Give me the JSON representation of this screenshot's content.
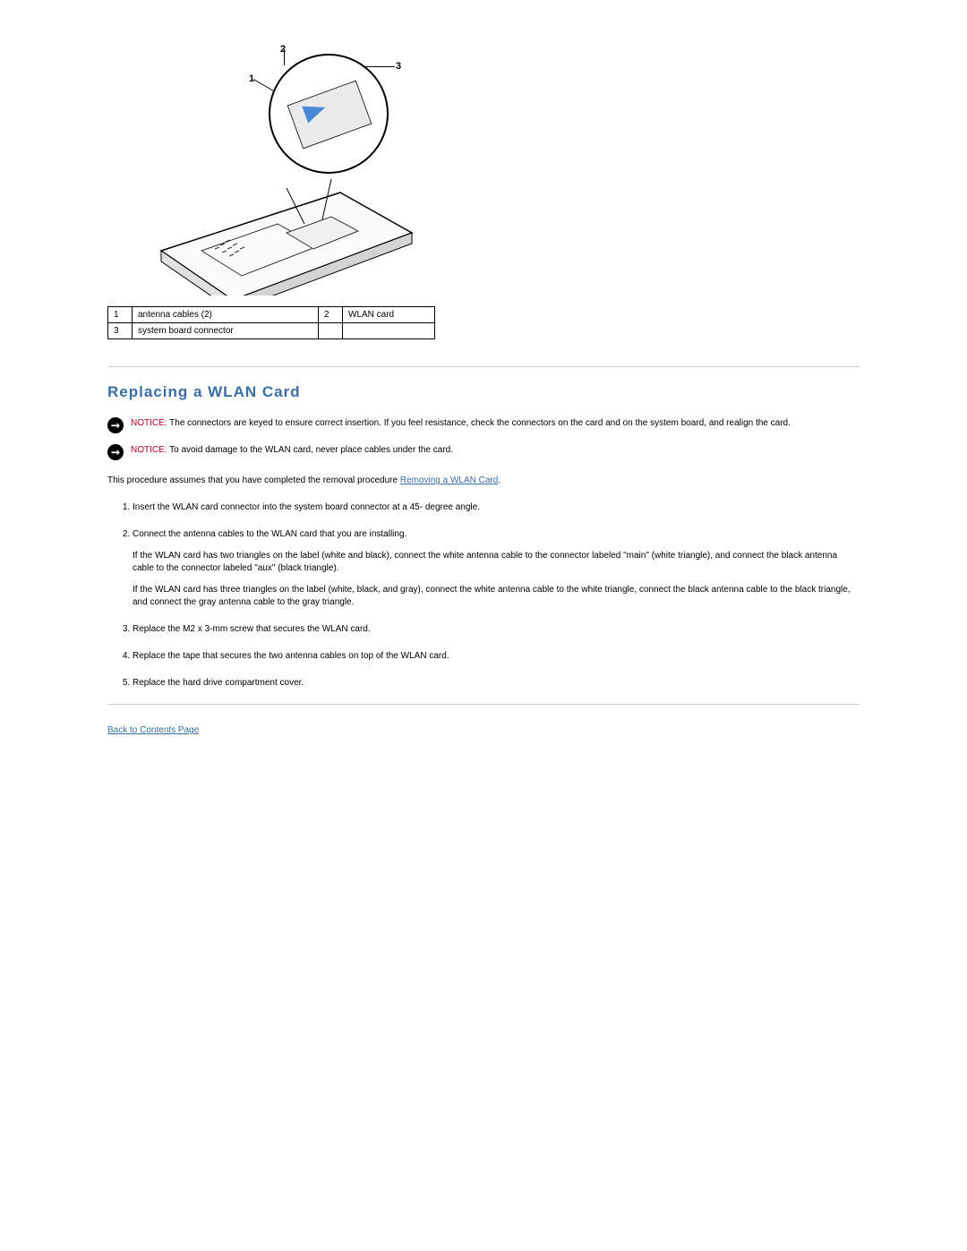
{
  "diagram": {
    "labels": {
      "one": "1",
      "two": "2",
      "three": "3"
    }
  },
  "legend": {
    "rows": [
      {
        "n1": "1",
        "d1": "antenna cables (2)",
        "n2": "2",
        "d2": "WLAN card"
      },
      {
        "n1": "3",
        "d1": "system board connector",
        "n2": "",
        "d2": ""
      }
    ]
  },
  "section_title": "Replacing a WLAN Card",
  "notices": [
    {
      "label": "NOTICE:",
      "text": " The connectors are keyed to ensure correct insertion. If you feel resistance, check the connectors on the card and on the system board, and realign the card."
    },
    {
      "label": "NOTICE:",
      "text": " To avoid damage to the WLAN card, never place cables under the card."
    }
  ],
  "intro": {
    "pre": "This procedure assumes that you have completed the removal procedure ",
    "link": "Removing a WLAN Card",
    "post": "."
  },
  "steps": [
    {
      "text": "Insert the WLAN card connector into the system board connector at a 45- degree angle."
    },
    {
      "text": "Connect the antenna cables to the WLAN card that you are installing.",
      "subs": [
        "If the WLAN card has two triangles on the label (white and black), connect the white antenna cable to the connector labeled \"main\" (white triangle), and connect the black antenna cable to the connector labeled \"aux\" (black triangle).",
        "If the WLAN card has three triangles on the label (white, black, and gray), connect the white antenna cable to the white triangle, connect the black antenna cable to the black triangle, and connect the gray antenna cable to the gray triangle."
      ]
    },
    {
      "text": "Replace the M2 x 3-mm screw that secures the WLAN card."
    },
    {
      "text": "Replace the tape that secures the two antenna cables on top of the WLAN card."
    },
    {
      "text": "Replace the hard drive compartment cover."
    }
  ],
  "back_link": "Back to Contents Page"
}
